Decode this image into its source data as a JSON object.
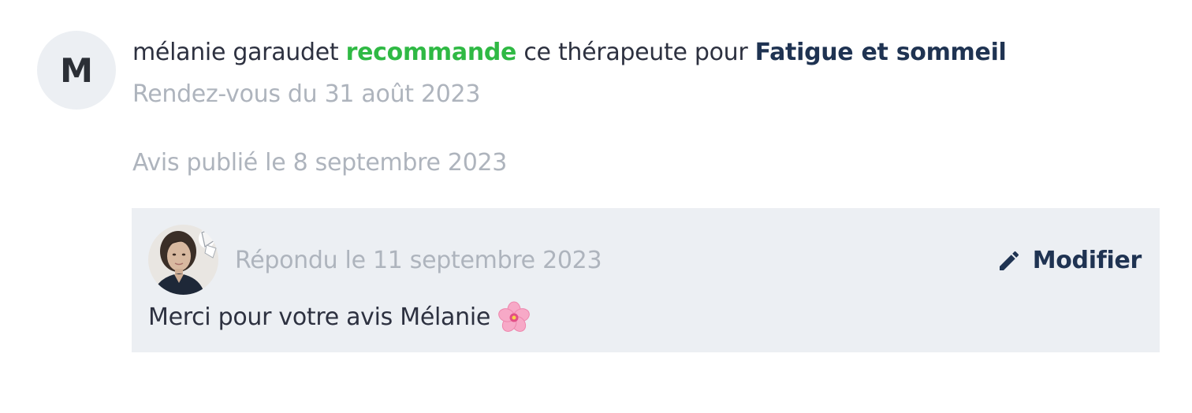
{
  "review": {
    "avatar_initial": "M",
    "author": "mélanie garaudet",
    "verb": "recommande",
    "middle_text": "ce thérapeute pour",
    "topic": "Fatigue et sommeil",
    "appointment_date": "Rendez-vous du 31 août 2023",
    "published_date": "Avis publié le 8 septembre 2023"
  },
  "reply": {
    "date": "Répondu le 11 septembre 2023",
    "edit_label": "Modifier",
    "message": "Merci pour votre avis Mélanie",
    "emoji_icon": "cherry-blossom-icon"
  },
  "colors": {
    "recommend_green": "#2fb944",
    "topic_navy": "#1f3352",
    "muted_gray": "#aeb4bd",
    "reply_background": "#eceff3"
  }
}
